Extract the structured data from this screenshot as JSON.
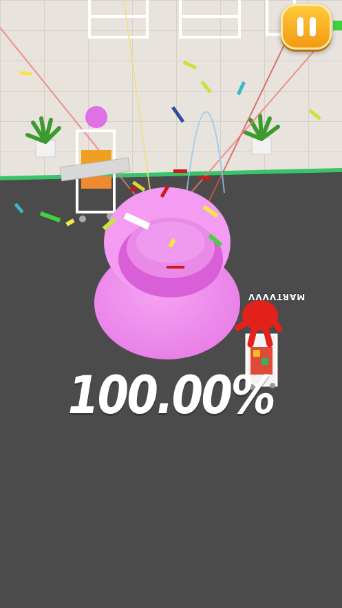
{
  "hud": {
    "progress_percent": "100.00%",
    "pause_icon": "pause-icon"
  },
  "opponent": {
    "name": "MARTVVVV"
  },
  "colors": {
    "floor_tile": "#e7e2dc",
    "ground": "#4a4a4a",
    "blob": "#f28cf0",
    "opponent": "#e0201a",
    "pause_button": "#f7b128",
    "floor_edge": "#3ec46d"
  }
}
